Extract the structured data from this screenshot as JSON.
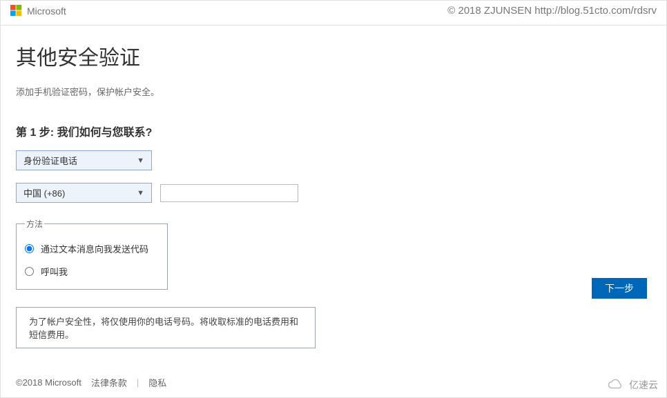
{
  "header": {
    "brand": "Microsoft",
    "watermark": "© 2018 ZJUNSEN http://blog.51cto.com/rdsrv"
  },
  "main": {
    "title": "其他安全验证",
    "subtitle": "添加手机验证密码，保护帐户安全。",
    "step_heading": "第 1 步: 我们如何与您联系?",
    "auth_method_selected": "身份验证电话",
    "country_selected": "中国 (+86)",
    "phone_value": "",
    "method_legend": "方法",
    "radio_sms": "通过文本消息向我发送代码",
    "radio_call": "呼叫我",
    "next_label": "下一步",
    "notice": "为了帐户安全性，将仅使用你的电话号码。将收取标准的电话费用和短信费用。"
  },
  "footer": {
    "copyright": "©2018 Microsoft",
    "legal": "法律条款",
    "privacy": "隐私"
  },
  "bottom_brand": "亿速云"
}
